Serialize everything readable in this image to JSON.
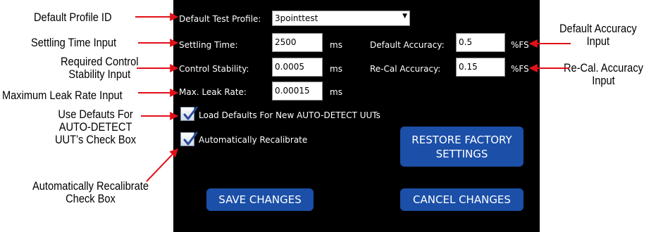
{
  "callouts": {
    "default_profile_id": [
      "Default Profile ID"
    ],
    "settling_time_input": [
      "Settling Time Input"
    ],
    "control_stability_input": [
      "Required Control",
      "Stability Input"
    ],
    "max_leak_rate_input": [
      "Maximum Leak Rate Input"
    ],
    "use_defaults_checkbox": [
      "Use Defauts For",
      "AUTO-DETECT",
      "UUT’s Check Box"
    ],
    "auto_recalibrate_checkbox": [
      "Automatically Recalibrate",
      "Check Box"
    ],
    "default_accuracy_input": [
      "Default Accuracy",
      "Input"
    ],
    "recal_accuracy_input": [
      "Re-Cal. Accuracy",
      "Input"
    ]
  },
  "panel": {
    "default_test_profile_label": "Default Test Profile:",
    "default_test_profile_value": "3pointtest",
    "settling_time_label": "Settling Time:",
    "settling_time_value": "2500",
    "settling_time_unit": "ms",
    "control_stability_label": "Control Stability:",
    "control_stability_value": "0.0005",
    "control_stability_unit": "ms",
    "max_leak_rate_label": "Max. Leak Rate:",
    "max_leak_rate_value": "0.00015",
    "max_leak_rate_unit": "ms",
    "default_accuracy_label": "Default Accuracy:",
    "default_accuracy_value": "0.5",
    "default_accuracy_unit": "%FS",
    "recal_accuracy_label": "Re-Cal Accuracy:",
    "recal_accuracy_value": "0.15",
    "recal_accuracy_unit": "%FS",
    "load_defaults_label": "Load Defaults For New AUTO-DETECT UUTs",
    "load_defaults_checked": true,
    "auto_recalibrate_label": "Automatically Recalibrate",
    "auto_recalibrate_checked": true,
    "restore_factory_button": "RESTORE FACTORY SETTINGS",
    "save_changes_button": "SAVE CHANGES",
    "cancel_changes_button": "CANCEL CHANGES"
  },
  "colors": {
    "panel_bg": "#000000",
    "button_bg": "#1b4fa8",
    "arrow": "#e0101a"
  }
}
